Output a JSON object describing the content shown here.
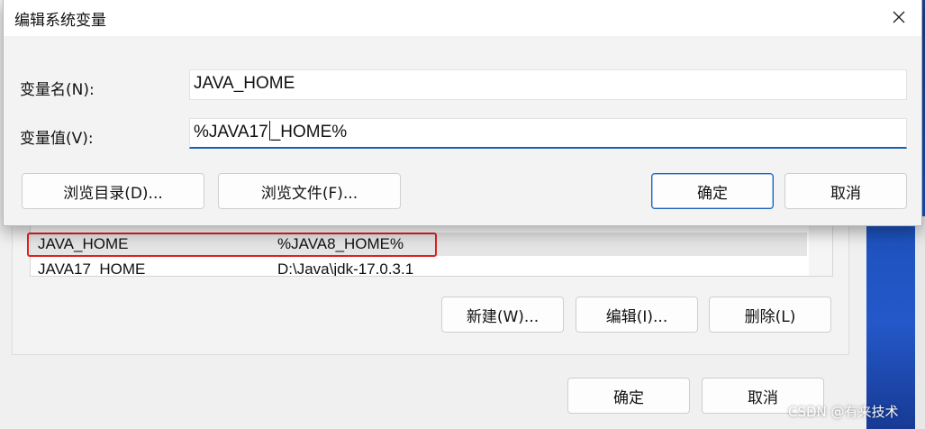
{
  "edit_dialog": {
    "title": "编辑系统变量",
    "name_label": "变量名(N):",
    "name_value": "JAVA_HOME",
    "value_label": "变量值(V):",
    "value_before_caret": "%JAVA17",
    "value_after_caret": "_HOME%",
    "browse_dir": "浏览目录(D)...",
    "browse_file": "浏览文件(F)...",
    "ok": "确定",
    "cancel": "取消"
  },
  "parent_dialog": {
    "variables": [
      {
        "name": "JAVA_HOME",
        "value": "%JAVA8_HOME%",
        "selected": true
      },
      {
        "name": "JAVA17_HOME",
        "value": "D:\\Java\\jdk-17.0.3.1",
        "selected": false
      }
    ],
    "new_button": "新建(W)...",
    "edit_button": "编辑(I)...",
    "delete_button": "删除(L)",
    "ok": "确定",
    "cancel": "取消"
  },
  "watermark": "CSDN @有来技术",
  "colors": {
    "highlight": "#e0201c",
    "focus_underline": "#1a5fb4"
  }
}
